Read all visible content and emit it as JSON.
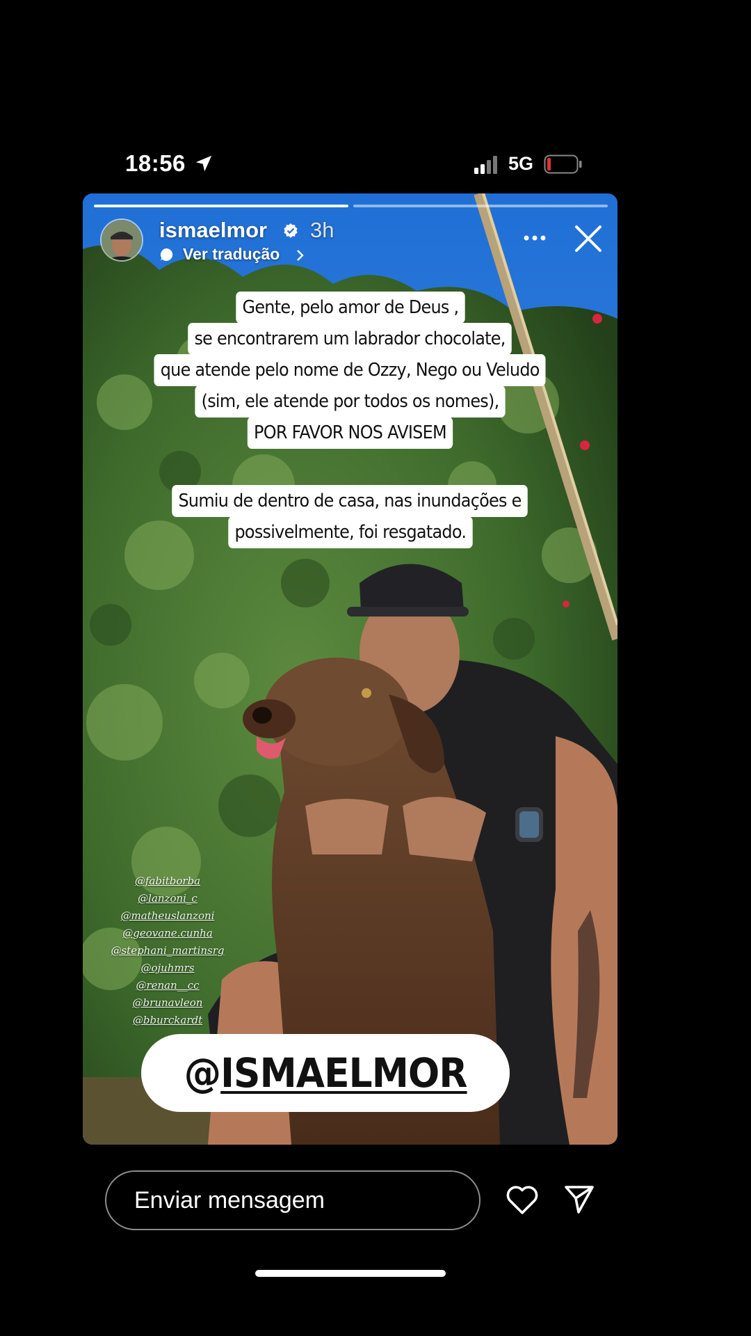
{
  "status_bar": {
    "time": "18:56",
    "network": "5G"
  },
  "story": {
    "username": "ismaelmor",
    "time_ago": "3h",
    "translate_label": "Ver tradução",
    "caption_block_1": [
      "Gente, pelo amor de Deus ,",
      "se encontrarem um labrador chocolate,",
      "que atende pelo nome de Ozzy, Nego ou Veludo",
      "(sim, ele atende por todos os nomes),",
      "POR FAVOR NOS AVISEM"
    ],
    "caption_block_2": [
      "Sumiu de dentro de casa, nas inundações e",
      "possivelmente, foi resgatado."
    ],
    "mentions": [
      "@fabitborba",
      "@lanzoni_c",
      "@matheuslanzoni",
      "@geovane.cunha",
      "@stephani_martinsrg",
      "@ojuhmrs",
      "@renan__cc",
      "@brunavleon",
      "@bburckardt"
    ],
    "sticker": {
      "at": "@",
      "handle": "ISMAELMOR"
    }
  },
  "reply_bar": {
    "placeholder": "Enviar mensagem"
  },
  "icons": {
    "location": "location-arrow-icon",
    "signal": "signal-icon",
    "battery": "battery-icon",
    "verified": "verified-badge-icon",
    "translate": "translate-bubble-icon",
    "more": "more-icon",
    "close": "close-icon",
    "like": "heart-icon",
    "send": "send-icon"
  },
  "colors": {
    "battery_low": "#e5322d",
    "sticker_bg": "#ffffff",
    "caption_bg": "#ffffff"
  }
}
